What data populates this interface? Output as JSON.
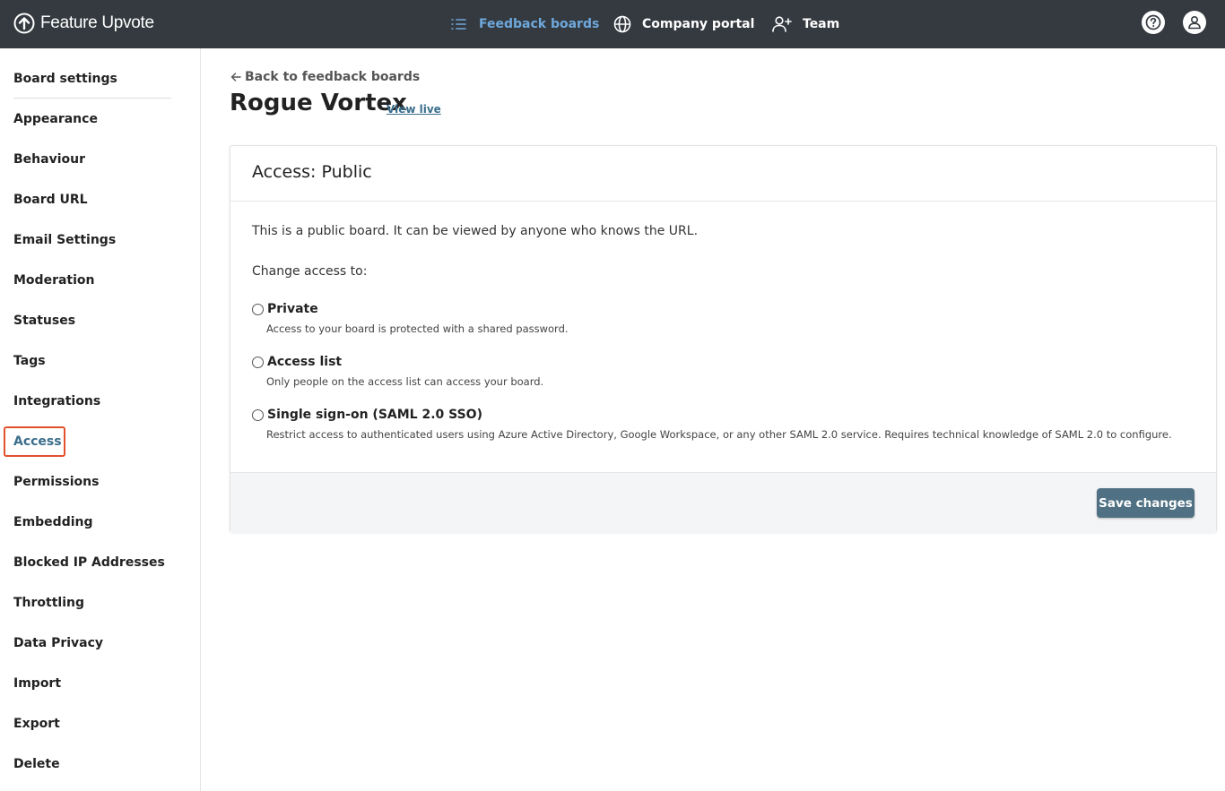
{
  "brand": {
    "name": "Feature Upvote"
  },
  "topnav": {
    "feedback_boards": "Feedback boards",
    "company_portal": "Company portal",
    "team": "Team"
  },
  "sidebar": {
    "items": [
      {
        "label": "Board settings"
      },
      {
        "label": "Appearance"
      },
      {
        "label": "Behaviour"
      },
      {
        "label": "Board URL"
      },
      {
        "label": "Email Settings"
      },
      {
        "label": "Moderation"
      },
      {
        "label": "Statuses"
      },
      {
        "label": "Tags"
      },
      {
        "label": "Integrations"
      },
      {
        "label": "Access"
      },
      {
        "label": "Permissions"
      },
      {
        "label": "Embedding"
      },
      {
        "label": "Blocked IP Addresses"
      },
      {
        "label": "Throttling"
      },
      {
        "label": "Data Privacy"
      },
      {
        "label": "Import"
      },
      {
        "label": "Export"
      },
      {
        "label": "Delete"
      }
    ]
  },
  "main": {
    "back_link": "Back to feedback boards",
    "board_name": "Rogue Vortex",
    "view_live": "View live",
    "card": {
      "title": "Access: Public",
      "description": "This is a public board. It can be viewed by anyone who knows the URL.",
      "change_label": "Change access to:",
      "options": [
        {
          "label": "Private",
          "help": "Access to your board is protected with a shared password."
        },
        {
          "label": "Access list",
          "help": "Only people on the access list can access your board."
        },
        {
          "label": "Single sign-on (SAML 2.0 SSO)",
          "help": "Restrict access to authenticated users using Azure Active Directory, Google Workspace, or any other SAML 2.0 service. Requires technical knowledge of SAML 2.0 to configure."
        }
      ],
      "save_label": "Save changes"
    }
  }
}
